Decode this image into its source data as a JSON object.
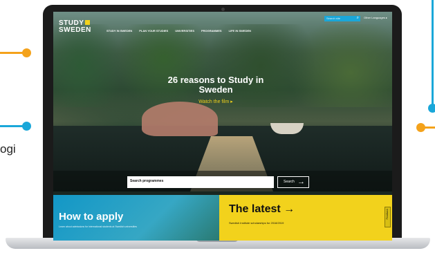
{
  "fragment_text": "ogi",
  "colors": {
    "accent_orange": "#f4a21b",
    "accent_blue": "#1aa7d9",
    "brand_yellow": "#f2d21c"
  },
  "site": {
    "logo_line1": "STUDY",
    "logo_line2": "SWEDEN",
    "nav": [
      "STUDY IN SWEDEN",
      "PLAN YOUR STUDIES",
      "UNIVERSITIES",
      "PROGRAMMES",
      "LIFE IN SWEDEN"
    ],
    "search_placeholder": "Search site",
    "search_icon": "search-icon",
    "languages_label": "Other Languages"
  },
  "hero": {
    "title": "26 reasons to Study in Sweden",
    "watch_label": "Watch the film ▸",
    "search_programmes_placeholder": "Search programmes",
    "search_button_label": "Search",
    "search_button_arrow": "→"
  },
  "panels": {
    "apply_heading": "How to apply",
    "apply_sub": "Learn about admissions for international students at Swedish universities",
    "latest_heading": "The latest →",
    "latest_sub": "Swedish Institute scholarships for 2018/2019",
    "feedback_label": "Feedback"
  }
}
